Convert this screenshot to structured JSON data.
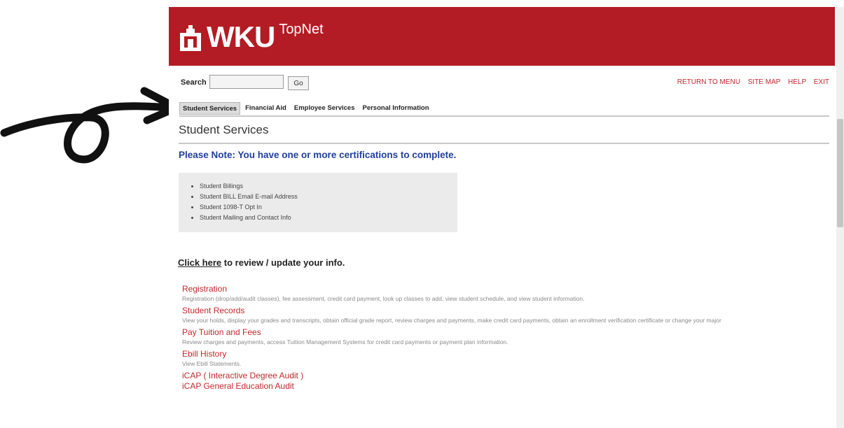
{
  "header": {
    "logo_text": "WKU",
    "app_name": "TopNet",
    "brand_color": "#b31c24"
  },
  "search": {
    "label": "Search",
    "value": "",
    "placeholder": "",
    "button": "Go"
  },
  "top_links": [
    "RETURN TO MENU",
    "SITE MAP",
    "HELP",
    "EXIT"
  ],
  "tabs": [
    "Student Services",
    "Financial Aid",
    "Employee Services",
    "Personal Information"
  ],
  "active_tab": "Student Services",
  "page": {
    "title": "Student Services",
    "note": "Please Note: You have one or more certifications to complete.",
    "certifications": [
      "Student Billings",
      "Student BILL Email E-mail Address",
      "Student 1098-T Opt In",
      "Student Mailing and Contact Info"
    ],
    "click_here": "Click here",
    "click_rest": " to review / update your info."
  },
  "menu": [
    {
      "title": "Registration",
      "desc": "Registration (drop/add/audit classes), fee assessment, credit card payment, look up classes to add, view student schedule, and view student information."
    },
    {
      "title": "Student Records",
      "desc": "View your holds, display your grades and transcripts, obtain official grade report, review charges and payments, make credit card payments, obtain an enrollment verification certificate or change your major"
    },
    {
      "title": "Pay Tuition and Fees",
      "desc": "Review charges and payments, access Tuition Management Systems for credit card payments or payment plan information."
    },
    {
      "title": "Ebill History",
      "desc": "View Ebill Statements."
    },
    {
      "title": "iCAP ( Interactive Degree Audit )",
      "desc": ""
    },
    {
      "title": "iCAP General Education Audit",
      "desc": ""
    }
  ],
  "icons": {
    "annotation": "hand-drawn-loop-arrow-icon",
    "logo": "wku-cupola-logo-icon"
  }
}
